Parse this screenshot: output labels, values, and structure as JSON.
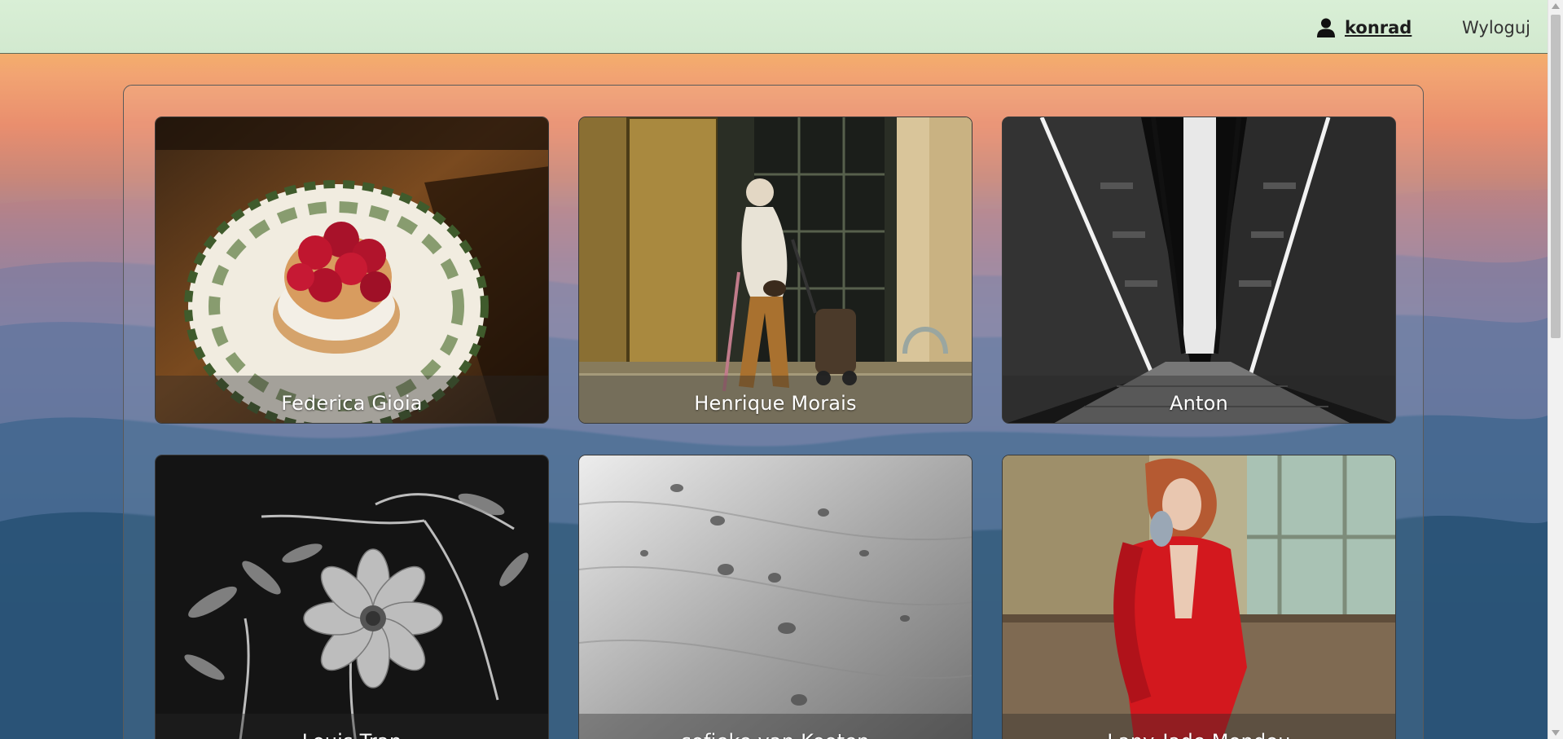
{
  "nav": {
    "username": "konrad",
    "logout_label": "Wyloguj"
  },
  "icons": {
    "user": "user-icon"
  },
  "gallery": {
    "cards": [
      {
        "author": "Federica Gioia"
      },
      {
        "author": "Henrique Morais"
      },
      {
        "author": "Anton"
      },
      {
        "author": "Louis Tran"
      },
      {
        "author": "sofieke van Kooten"
      },
      {
        "author": "Lany-Jade Mondou"
      }
    ]
  },
  "colors": {
    "navbar": "#d9efd6",
    "caption_text": "#ffffff"
  }
}
